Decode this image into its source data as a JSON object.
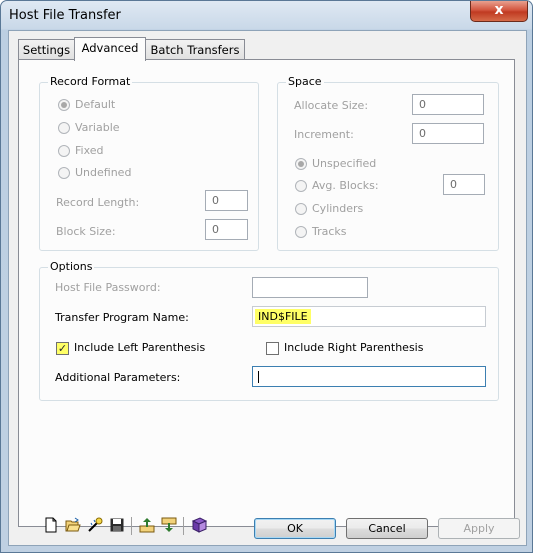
{
  "window": {
    "title": "Host File Transfer",
    "close_glyph": "x"
  },
  "tabs": [
    {
      "label": "Settings",
      "active": false
    },
    {
      "label": "Advanced",
      "active": true
    },
    {
      "label": "Batch Transfers",
      "active": false
    }
  ],
  "record_format": {
    "legend": "Record Format",
    "options": [
      {
        "label": "Default",
        "selected": true
      },
      {
        "label": "Variable",
        "selected": false
      },
      {
        "label": "Fixed",
        "selected": false
      },
      {
        "label": "Undefined",
        "selected": false
      }
    ],
    "record_length_label": "Record Length:",
    "record_length_value": "0",
    "block_size_label": "Block Size:",
    "block_size_value": "0"
  },
  "space": {
    "legend": "Space",
    "allocate_size_label": "Allocate Size:",
    "allocate_size_value": "0",
    "increment_label": "Increment:",
    "increment_value": "0",
    "options": [
      {
        "label": "Unspecified",
        "selected": true
      },
      {
        "label": "Avg. Blocks:",
        "selected": false
      },
      {
        "label": "Cylinders",
        "selected": false
      },
      {
        "label": "Tracks",
        "selected": false
      }
    ],
    "avg_blocks_value": "0"
  },
  "options": {
    "legend": "Options",
    "host_password_label": "Host File Password:",
    "host_password_value": "",
    "transfer_program_label": "Transfer Program Name:",
    "transfer_program_value": "IND$FILE",
    "highlight_color": "#ffff66",
    "include_left_label": "Include Left Parenthesis",
    "include_left_checked": true,
    "include_right_label": "Include Right Parenthesis",
    "include_right_checked": false,
    "additional_params_label": "Additional Parameters:",
    "additional_params_value": ""
  },
  "toolbar_icons": [
    "new-file-icon",
    "open-folder-icon",
    "wizard-icon",
    "save-icon",
    "upload-icon",
    "download-icon",
    "book-icon"
  ],
  "buttons": {
    "ok": "OK",
    "cancel": "Cancel",
    "apply": "Apply"
  },
  "colors": {
    "title_bar": "#c9d8e8",
    "close_button": "#c8452d",
    "focus_border": "#3c7fb1"
  }
}
